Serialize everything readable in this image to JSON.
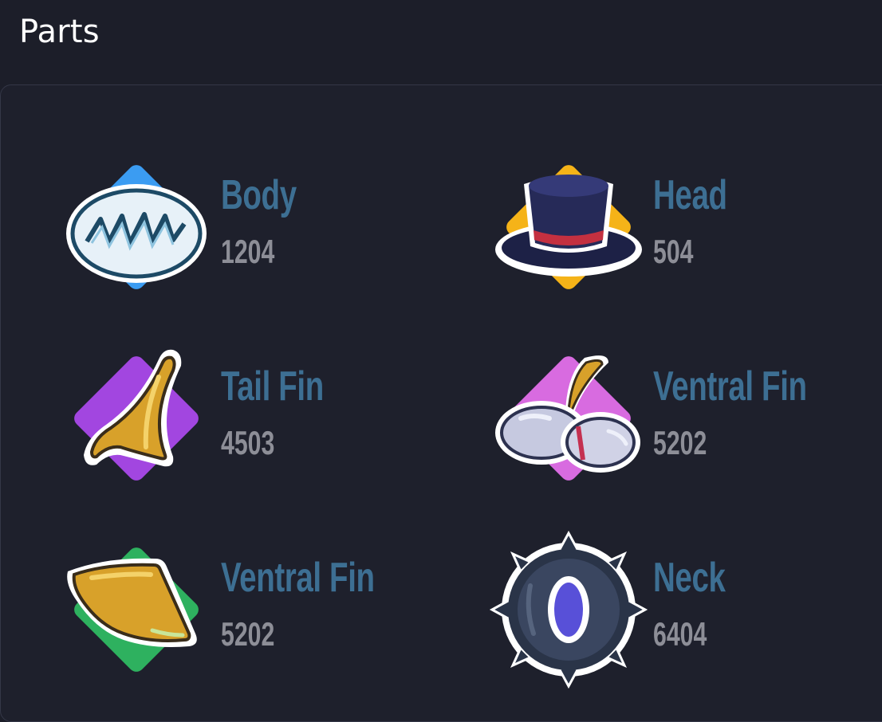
{
  "section": {
    "title": "Parts"
  },
  "parts": [
    {
      "name": "Body",
      "id": "1204",
      "badge_color": "#3b9cf2",
      "icon": "zigzag-mouth-icon"
    },
    {
      "name": "Head",
      "id": "504",
      "badge_color": "#f5b318",
      "icon": "top-hat-icon"
    },
    {
      "name": "Tail Fin",
      "id": "4503",
      "badge_color": "#a246e0",
      "icon": "golden-horn-icon"
    },
    {
      "name": "Ventral Fin",
      "id": "5202",
      "badge_color": "#d86be0",
      "icon": "bandaged-fin-icon"
    },
    {
      "name": "Ventral Fin",
      "id": "5202",
      "badge_color": "#2eb15f",
      "icon": "golden-leaf-fin-icon"
    },
    {
      "name": "Neck",
      "id": "6404",
      "badge_color": "#6156f0",
      "icon": "spiked-tire-icon"
    }
  ]
}
